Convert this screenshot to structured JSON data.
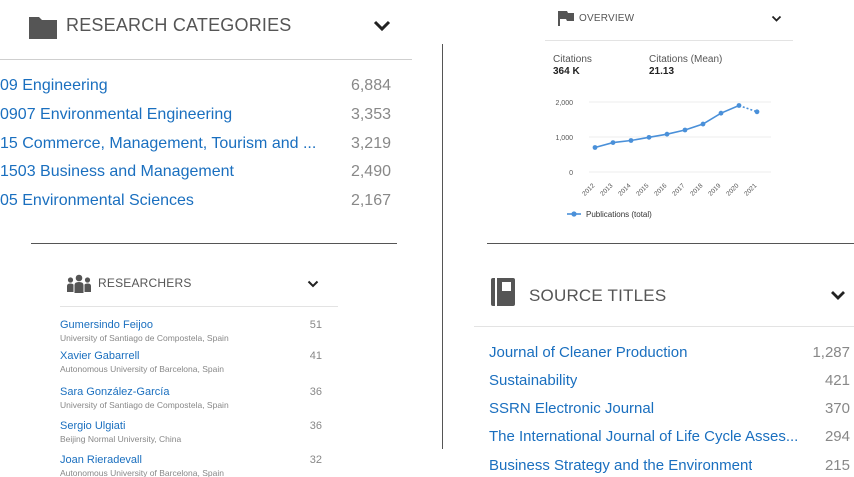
{
  "research": {
    "title": "RESEARCH CATEGORIES",
    "items": [
      {
        "label": "09 Engineering",
        "count": "6,884"
      },
      {
        "label": "0907 Environmental Engineering",
        "count": "3,353"
      },
      {
        "label": "15 Commerce, Management, Tourism and ...",
        "count": "3,219"
      },
      {
        "label": "1503 Business and Management",
        "count": "2,490"
      },
      {
        "label": "05 Environmental Sciences",
        "count": "2,167"
      }
    ]
  },
  "researchers": {
    "title": "RESEARCHERS",
    "items": [
      {
        "name": "Gumersindo Feijoo",
        "affiliation": "University of Santiago de Compostela, Spain",
        "count": "51"
      },
      {
        "name": "Xavier Gabarrell",
        "affiliation": "Autonomous University of Barcelona, Spain",
        "count": "41"
      },
      {
        "name": "Sara González-García",
        "affiliation": "University of Santiago de Compostela, Spain",
        "count": "36"
      },
      {
        "name": "Sergio Ulgiati",
        "affiliation": "Beijing Normal University, China",
        "count": "36"
      },
      {
        "name": "Joan Rieradevall",
        "affiliation": "Autonomous University of Barcelona, Spain",
        "count": "32"
      }
    ]
  },
  "overview": {
    "title": "OVERVIEW",
    "stats": [
      {
        "label": "Citations",
        "value": "364 K"
      },
      {
        "label": "Citations (Mean)",
        "value": "21.13"
      }
    ]
  },
  "sources": {
    "title": "SOURCE TITLES",
    "items": [
      {
        "label": "Journal of Cleaner Production",
        "count": "1,287"
      },
      {
        "label": "Sustainability",
        "count": "421"
      },
      {
        "label": "SSRN Electronic Journal",
        "count": "370"
      },
      {
        "label": "The International Journal of Life Cycle Asses...",
        "count": "294"
      },
      {
        "label": "Business Strategy and the Environment",
        "count": "215"
      }
    ]
  },
  "colors": {
    "link": "#1a6fbf",
    "series": "#4a90d9"
  },
  "chart_data": {
    "type": "line",
    "categories": [
      "2012",
      "2013",
      "2014",
      "2015",
      "2016",
      "2017",
      "2018",
      "2019",
      "2020",
      "2021"
    ],
    "series": [
      {
        "name": "Publications (total)",
        "values": [
          700,
          840,
          900,
          990,
          1080,
          1200,
          1370,
          1680,
          1900,
          1720
        ]
      }
    ],
    "yticks": [
      "0",
      "1,000",
      "2,000"
    ],
    "ylim": [
      0,
      2000
    ],
    "legend": "bottom-left",
    "dashed_last_segment": true
  }
}
